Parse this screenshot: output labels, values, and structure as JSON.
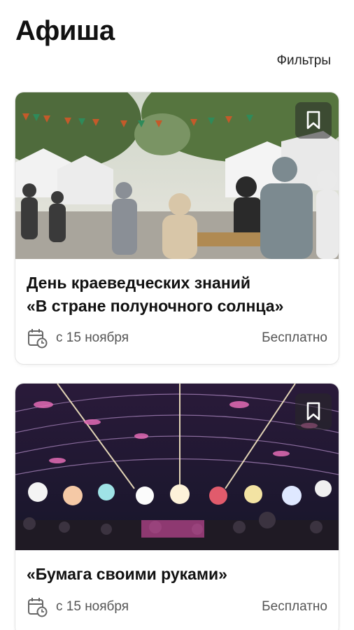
{
  "header": {
    "title": "Афиша",
    "filters_label": "Фильтры"
  },
  "events": [
    {
      "title_lines": [
        "День краеведческих знаний",
        "«В стране полуночного солнца»"
      ],
      "date": "с 15 ноября",
      "price": "Бесплатно",
      "image": "outdoor-fair-photo",
      "icon": "bookmark-icon"
    },
    {
      "title_lines": [
        "«Бумага своими руками»"
      ],
      "date": "с 15 ноября",
      "price": "Бесплатно",
      "image": "lantern-tent-photo",
      "icon": "bookmark-icon"
    }
  ],
  "icons": {
    "calendar": "calendar-clock-icon",
    "bookmark": "bookmark-icon"
  },
  "colors": {
    "text": "#111111",
    "secondary_text": "#555555",
    "card_border": "#e4e4e4"
  }
}
